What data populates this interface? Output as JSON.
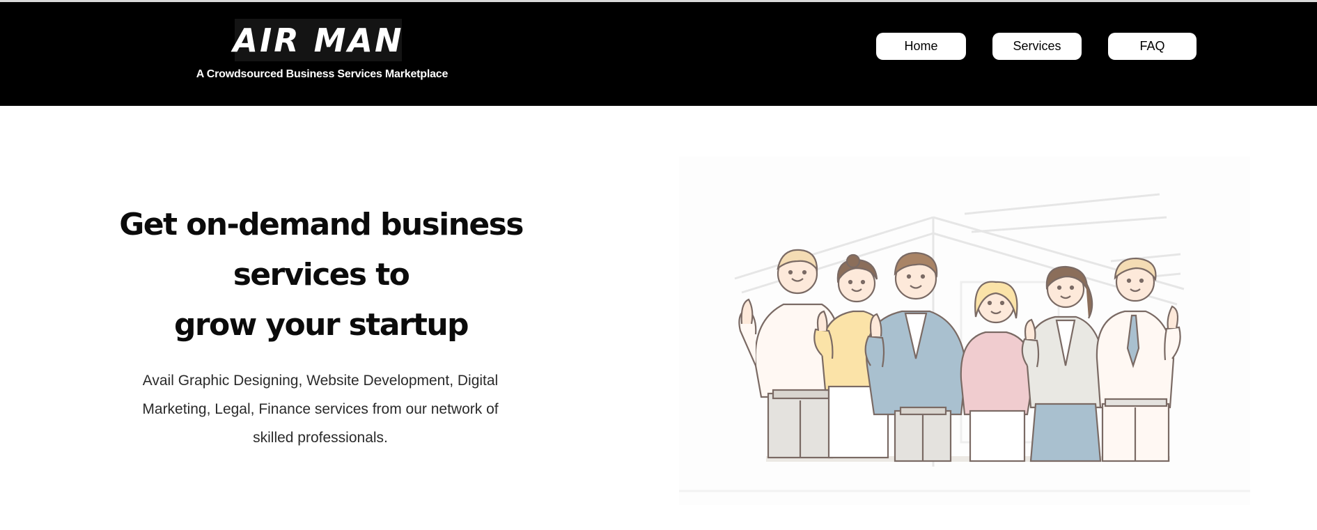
{
  "header": {
    "logo_text": "AIR MAN",
    "tagline": "A Crowdsourced Business Services Marketplace",
    "nav": [
      {
        "label": "Home"
      },
      {
        "label": "Services"
      },
      {
        "label": "FAQ"
      }
    ]
  },
  "hero": {
    "headline_line1": "Get on-demand business services to",
    "headline_line2": "grow your startup",
    "description_line1": "Avail Graphic Designing, Website Development, Digital",
    "description_line2": "Marketing, Legal, Finance services from our network of",
    "description_line3": "skilled professionals."
  },
  "colors": {
    "header_bg": "#000000",
    "button_bg": "#ffffff",
    "text_dark": "#0b0b0b",
    "illustration_yellow": "#fbe3a8",
    "illustration_blue": "#a9c0cf",
    "illustration_pink": "#f0cccf",
    "illustration_gray": "#e4e2de"
  },
  "illustration": {
    "subject": "team-thumbs-up-illustration"
  }
}
